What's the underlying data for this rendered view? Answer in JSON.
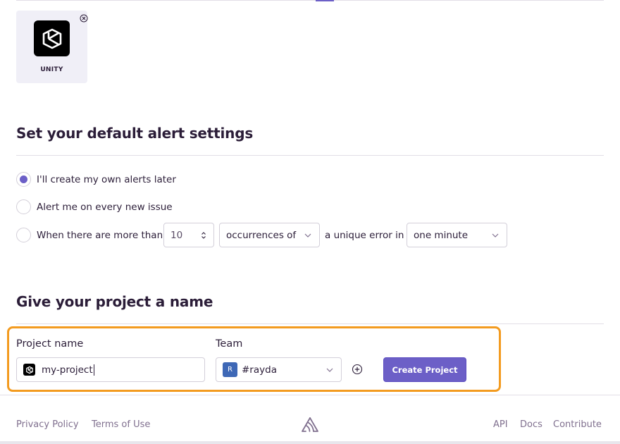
{
  "platform": {
    "name": "UNITY"
  },
  "alerts": {
    "heading": "Set your default alert settings",
    "options": [
      {
        "label": "I'll create my own alerts later",
        "checked": true
      },
      {
        "label": "Alert me on every new issue",
        "checked": false
      },
      {
        "label": "When there are more than",
        "checked": false
      }
    ],
    "threshold_value": "10",
    "metric_select": "occurrences of",
    "connector_text": "a unique error in",
    "interval_select": "one minute"
  },
  "project": {
    "heading": "Give your project a name",
    "name_label": "Project name",
    "name_value": "my-project",
    "team_label": "Team",
    "team_avatar": "R",
    "team_value": "#rayda",
    "create_button": "Create Project"
  },
  "footer": {
    "privacy": "Privacy Policy",
    "terms": "Terms of Use",
    "api": "API",
    "docs": "Docs",
    "contribute": "Contribute"
  },
  "colors": {
    "accent": "#6c5fc7",
    "highlight": "#f39b20",
    "team_avatar": "#3e68b6"
  }
}
